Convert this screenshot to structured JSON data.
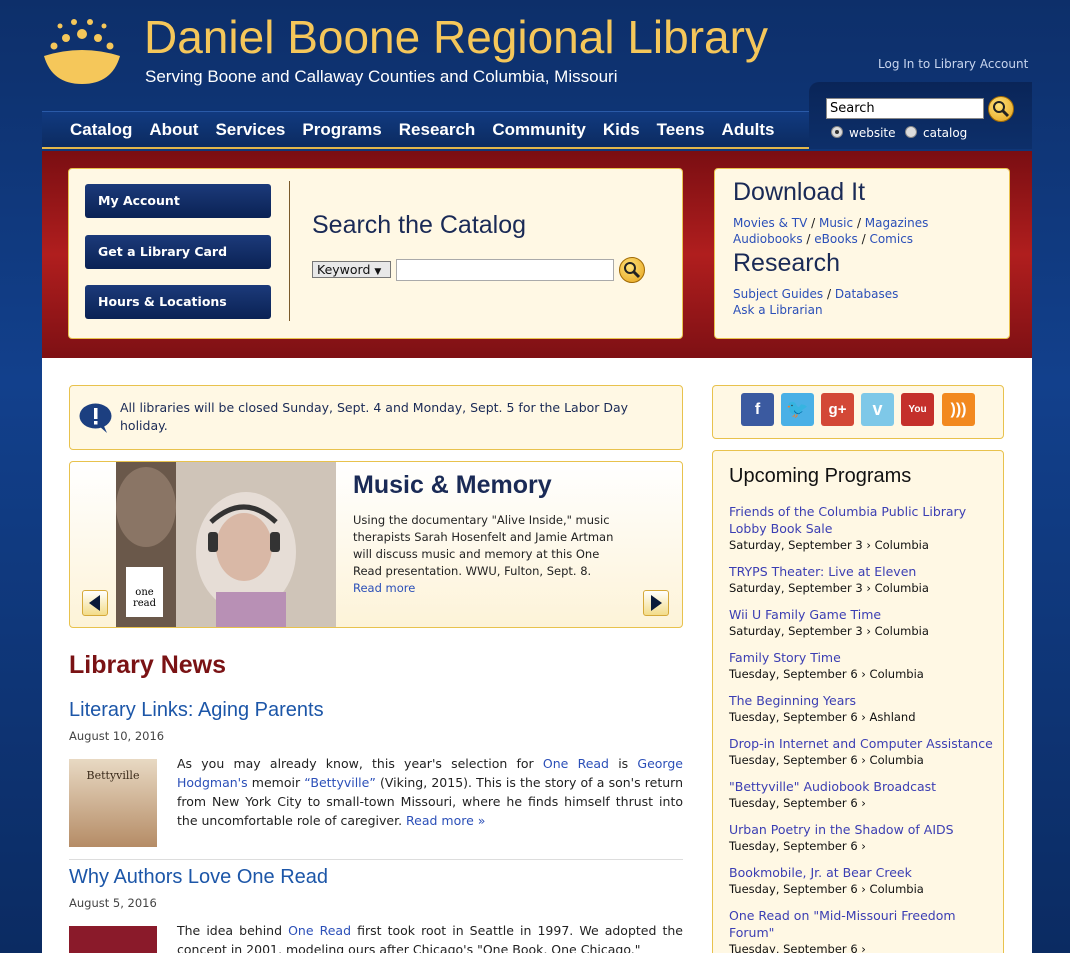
{
  "header": {
    "title": "Daniel Boone Regional Library",
    "tagline": "Serving Boone and Callaway Counties and Columbia, Missouri",
    "login_label": "Log In to Library Account"
  },
  "nav": [
    "Catalog",
    "About",
    "Services",
    "Programs",
    "Research",
    "Community",
    "Kids",
    "Teens",
    "Adults"
  ],
  "site_search": {
    "value": "Search",
    "options": [
      "website",
      "catalog"
    ],
    "selected": "website"
  },
  "quick_links": [
    "My Account",
    "Get a Library Card",
    "Hours & Locations"
  ],
  "catalog_search": {
    "title": "Search the Catalog",
    "field_select": "Keyword",
    "value": ""
  },
  "download": {
    "heading": "Download It",
    "row1": [
      "Movies & TV",
      "Music",
      "Magazines"
    ],
    "row2": [
      "Audiobooks",
      "eBooks",
      "Comics"
    ]
  },
  "research": {
    "heading": "Research",
    "row1": [
      "Subject Guides",
      "Databases"
    ],
    "row2": [
      "Ask a Librarian"
    ]
  },
  "alert": {
    "text": "All libraries will be closed Sunday, Sept. 4 and Monday, Sept. 5 for the Labor Day holiday."
  },
  "slide": {
    "title": "Music & Memory",
    "text": "Using the documentary \"Alive Inside,\" music therapists Sarah Hosenfelt and Jamie Artman will discuss music and memory at this One Read presentation. WWU, Fulton, Sept. 8.",
    "read_more": "Read more",
    "badge": "one read"
  },
  "news": {
    "heading": "Library News",
    "articles": [
      {
        "title": "Literary Links: Aging Parents",
        "date": "August 10, 2016",
        "thumb_label": "Bettyville",
        "body_1": "As you may already know, this year's selection for ",
        "link_1": "One Read",
        "body_2": " is ",
        "link_2": "George Hodgman's",
        "body_3": " memoir ",
        "link_3": "“Bettyville”",
        "body_4": " (Viking, 2015). This is the story of a son's return from New York City to small-town Missouri, where he finds himself thrust into the uncomfortable role of caregiver. ",
        "more": "Read more »"
      },
      {
        "title": "Why Authors Love One Read",
        "date": "August 5, 2016",
        "body_1": "The idea behind ",
        "link_1": "One Read",
        "body_2": " first took root in Seattle in 1997. We adopted the concept in 2001, modeling ours after Chicago's \"One Book, One Chicago.\""
      }
    ]
  },
  "social": [
    "facebook",
    "twitter",
    "google-plus",
    "vimeo",
    "youtube",
    "rss"
  ],
  "programs": {
    "title": "Upcoming Programs",
    "items": [
      {
        "name": "Friends of the Columbia Public Library Lobby Book Sale",
        "meta": "Saturday, September 3 › Columbia"
      },
      {
        "name": "TRYPS Theater: Live at Eleven",
        "meta": "Saturday, September 3 › Columbia"
      },
      {
        "name": "Wii U Family Game Time",
        "meta": "Saturday, September 3 › Columbia"
      },
      {
        "name": "Family Story Time",
        "meta": "Tuesday, September 6 › Columbia"
      },
      {
        "name": "The Beginning Years",
        "meta": "Tuesday, September 6 › Ashland"
      },
      {
        "name": "Drop-in Internet and Computer Assistance",
        "meta": "Tuesday, September 6 › Columbia"
      },
      {
        "name": "\"Bettyville\" Audiobook Broadcast",
        "meta": "Tuesday, September 6 ›"
      },
      {
        "name": "Urban Poetry in the Shadow of AIDS",
        "meta": "Tuesday, September 6 ›"
      },
      {
        "name": "Bookmobile, Jr. at Bear Creek",
        "meta": "Tuesday, September 6 › Columbia"
      },
      {
        "name": "One Read on \"Mid-Missouri Freedom Forum\"",
        "meta": "Tuesday, September 6 ›"
      }
    ]
  },
  "colors": {
    "brand_gold": "#f5c75a",
    "navy": "#1a2a56",
    "red_band": "#b01e1e",
    "link": "#2b4fb8"
  }
}
